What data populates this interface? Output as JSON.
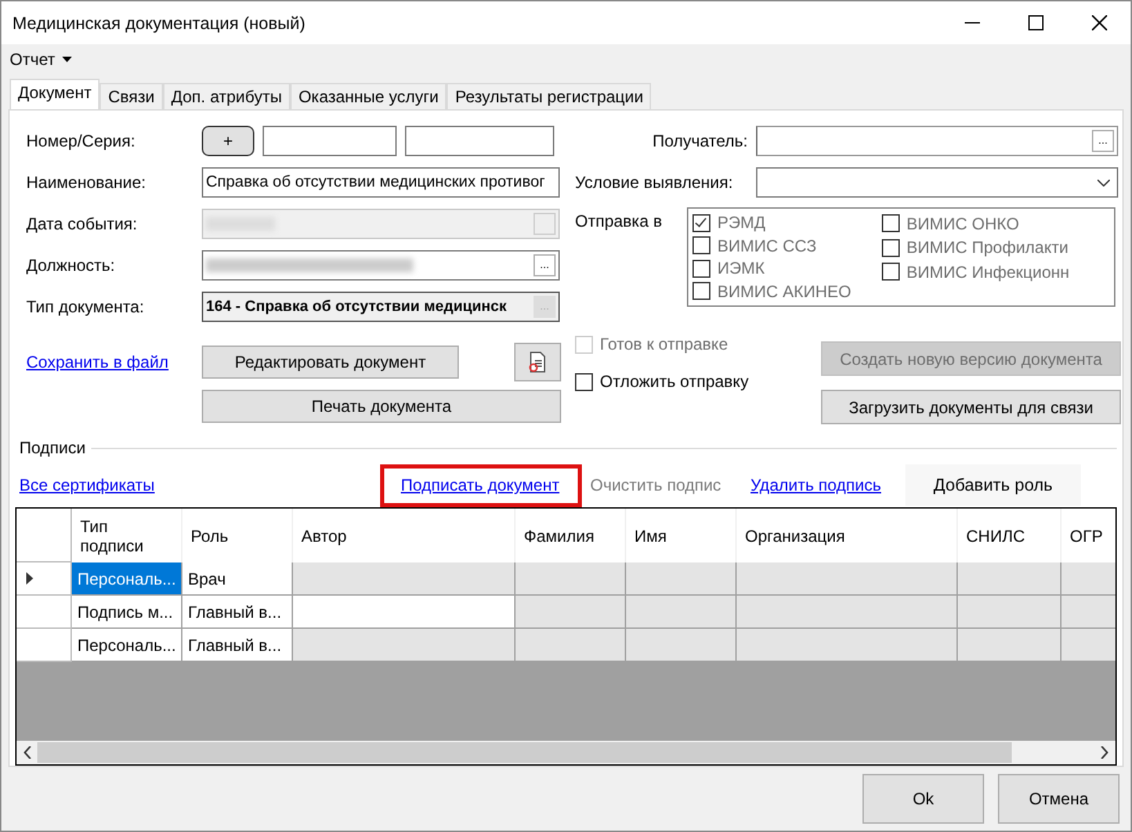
{
  "window": {
    "title": "Медицинская документация (новый)"
  },
  "menu": [
    {
      "label": "Отчет"
    }
  ],
  "tabs": [
    {
      "label": "Документ",
      "selected": true
    },
    {
      "label": "Связи",
      "selected": false
    },
    {
      "label": "Доп. атрибуты",
      "selected": false
    },
    {
      "label": "Оказанные услуги",
      "selected": false
    },
    {
      "label": "Результаты регистрации",
      "selected": false
    }
  ],
  "form": {
    "number": {
      "label": "Номер/Серия:",
      "button": "+"
    },
    "name": {
      "label": "Наименование:",
      "value": "Справка об отсутствии медицинских противог"
    },
    "event_date": {
      "label": "Дата события:",
      "disabled": true
    },
    "position": {
      "label": "Должность:",
      "button": "..."
    },
    "doc_type": {
      "label": "Тип документа:",
      "value": "164 - Справка об отсутствии медицинск",
      "button": "..."
    },
    "recipient": {
      "label": "Получатель:",
      "button": "..."
    },
    "condition": {
      "label": "Условие выявления:"
    },
    "send_to": {
      "label": "Отправка в",
      "options": [
        {
          "label": "РЭМД",
          "checked": true
        },
        {
          "label": "ВИМИС ССЗ",
          "checked": false
        },
        {
          "label": "ИЭМК",
          "checked": false
        },
        {
          "label": "ВИМИС АКИНЕО",
          "checked": false
        },
        {
          "label": "ВИМИС ОНКО",
          "checked": false
        },
        {
          "label": "ВИМИС Профилакти",
          "checked": false
        },
        {
          "label": "ВИМИС Инфекционн",
          "checked": false
        }
      ]
    },
    "save_link": "Сохранить в файл",
    "edit_button": "Редактировать документ",
    "print_button": "Печать документа",
    "ready": {
      "label": "Готов к отправке",
      "checked": false,
      "disabled": true
    },
    "postpone": {
      "label": "Отложить отправку",
      "checked": false,
      "disabled": false
    },
    "new_version_button": {
      "label": "Создать новую версию документа",
      "disabled": true
    },
    "load_button": {
      "label": "Загрузить документы для связи",
      "disabled": false
    }
  },
  "signatures": {
    "title": "Подписи",
    "actions": [
      {
        "kind": "link",
        "label": "Все сертификаты",
        "highlighted": false
      },
      {
        "kind": "link",
        "label": "Подписать документ",
        "highlighted": true
      },
      {
        "kind": "disabled-link",
        "label": "Очистить подпис",
        "highlighted": false
      },
      {
        "kind": "link",
        "label": "Удалить подпись",
        "highlighted": false
      },
      {
        "kind": "button",
        "label": "Добавить роль",
        "highlighted": false
      }
    ],
    "table": {
      "columns": [
        "Тип подписи",
        "Роль",
        "Автор",
        "Фамилия",
        "Имя",
        "Организация",
        "СНИЛС",
        "ОГР"
      ],
      "rows": [
        {
          "selected": true,
          "cells": [
            {
              "kind": "text",
              "text": "Персональ..."
            },
            {
              "kind": "text",
              "text": "Врач"
            },
            {
              "kind": "blurred"
            },
            {
              "kind": "blurred"
            },
            {
              "kind": "blurred"
            },
            {
              "kind": "blurred"
            },
            {
              "kind": "blurred"
            },
            {
              "kind": "blurred"
            }
          ]
        },
        {
          "selected": false,
          "cells": [
            {
              "kind": "text",
              "text": "Подпись м..."
            },
            {
              "kind": "text",
              "text": "Главный в..."
            },
            {
              "kind": "empty"
            },
            {
              "kind": "blurred"
            },
            {
              "kind": "blurred"
            },
            {
              "kind": "blurred"
            },
            {
              "kind": "blurred"
            },
            {
              "kind": "blurred"
            }
          ]
        },
        {
          "selected": false,
          "cells": [
            {
              "kind": "text",
              "text": "Персональ..."
            },
            {
              "kind": "text",
              "text": "Главный в..."
            },
            {
              "kind": "blurred"
            },
            {
              "kind": "blurred"
            },
            {
              "kind": "blurred"
            },
            {
              "kind": "blurred"
            },
            {
              "kind": "blurred"
            },
            {
              "kind": "blurred"
            }
          ]
        }
      ]
    }
  },
  "buttons": [
    "Ok",
    "Отмена"
  ]
}
